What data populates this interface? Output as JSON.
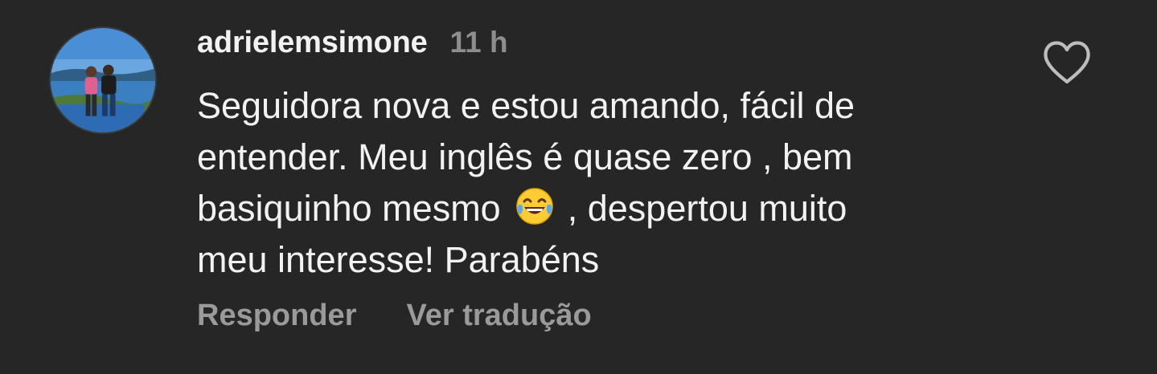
{
  "comment": {
    "username": "adrielemsimone",
    "time": "11 h",
    "text_lines": [
      "Seguidora nova e estou amando, fácil de",
      "entender. Meu inglês é quase zero , bem"
    ],
    "line3_before_emoji": "basiquinho mesmo",
    "line3_after_emoji": ", despertou muito",
    "line4": "meu interesse! Parabéns",
    "emoji": "face-with-tears-of-joy",
    "avatar_icon": "profile-photo",
    "like_icon": "heart-outline-icon"
  },
  "actions": {
    "reply_label": "Responder",
    "translate_label": "Ver tradução"
  },
  "colors": {
    "background": "#262626",
    "text_primary": "#f2f2f2",
    "text_secondary": "#8e8e8e",
    "actions": "#9a9a9a",
    "like_icon": "#bdbdbd"
  }
}
